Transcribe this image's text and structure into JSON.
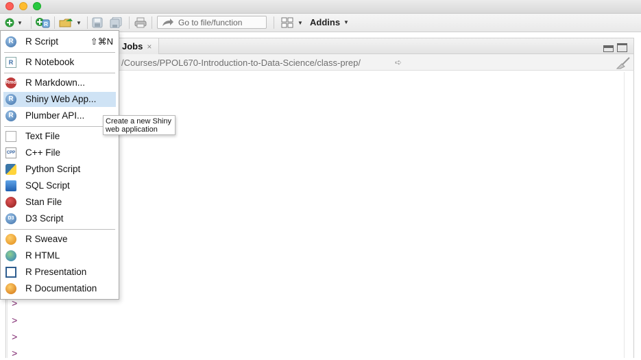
{
  "toolbar": {
    "goto_placeholder": "Go to file/function",
    "addins_label": "Addins"
  },
  "editor": {
    "tab_jobs": "Jobs",
    "tab_close": "×",
    "path": "/Courses/PPOL670-Introduction-to-Data-Science/class-prep/",
    "prompt": ">"
  },
  "menu": {
    "items": [
      {
        "label": "R Script",
        "shortcut": "⇧⌘N",
        "icon": "r-script-icon"
      },
      {
        "label": "R Notebook",
        "icon": "r-notebook-icon"
      },
      {
        "label": "R Markdown...",
        "icon": "r-markdown-icon"
      },
      {
        "label": "Shiny Web App...",
        "icon": "shiny-icon",
        "selected": true
      },
      {
        "label": "Plumber API...",
        "icon": "plumber-icon"
      },
      {
        "label": "Text File",
        "icon": "text-file-icon"
      },
      {
        "label": "C++ File",
        "icon": "cpp-icon"
      },
      {
        "label": "Python Script",
        "icon": "python-icon"
      },
      {
        "label": "SQL Script",
        "icon": "sql-icon"
      },
      {
        "label": "Stan File",
        "icon": "stan-icon"
      },
      {
        "label": "D3 Script",
        "icon": "d3-icon"
      },
      {
        "label": "R Sweave",
        "icon": "sweave-icon"
      },
      {
        "label": "R HTML",
        "icon": "html-icon"
      },
      {
        "label": "R Presentation",
        "icon": "presentation-icon"
      },
      {
        "label": "R Documentation",
        "icon": "documentation-icon"
      }
    ]
  },
  "tooltip": {
    "line1": "Create a new Shiny",
    "line2": "web application"
  },
  "colors": {
    "selection": "#cfe3f5",
    "prompt": "#7a1f6a",
    "close": "#fd5f57",
    "minimize": "#febc2e",
    "maximize": "#28c840"
  }
}
